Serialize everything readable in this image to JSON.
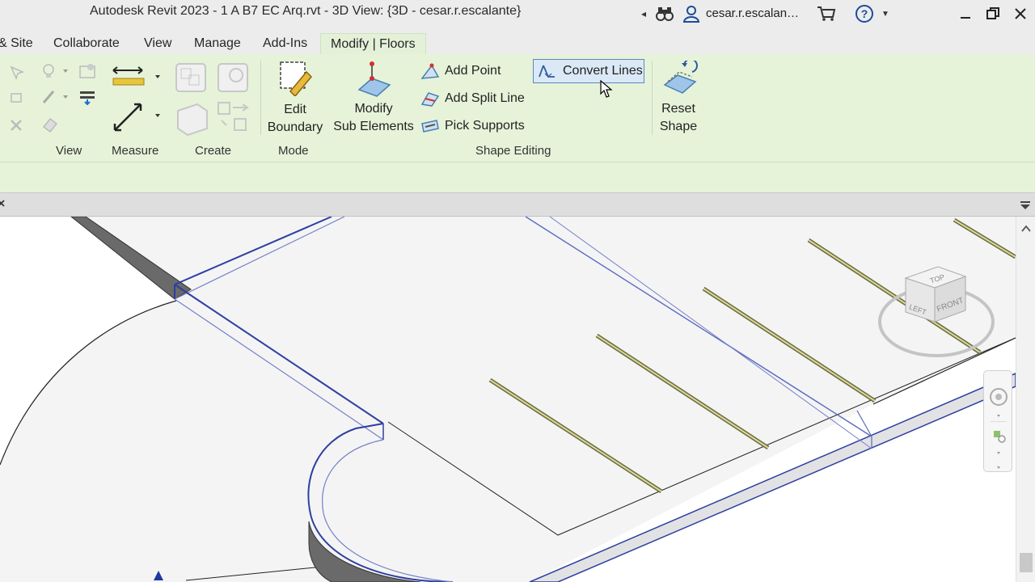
{
  "titlebar": {
    "title": "Autodesk Revit 2023 - 1 A B7 EC Arq.rvt - 3D View: {3D - cesar.r.escalante}",
    "user": "cesar.r.escalan…"
  },
  "tabs": [
    {
      "label": "& Site"
    },
    {
      "label": "Collaborate"
    },
    {
      "label": "View"
    },
    {
      "label": "Manage"
    },
    {
      "label": "Add-Ins"
    },
    {
      "label": "Modify | Floors"
    }
  ],
  "ribbon": {
    "panels": {
      "view": "View",
      "measure": "Measure",
      "create": "Create",
      "mode": "Mode",
      "shape_editing": "Shape Editing"
    },
    "edit_boundary": {
      "line1": "Edit",
      "line2": "Boundary"
    },
    "modify_sub": {
      "line1": "Modify",
      "line2": "Sub Elements"
    },
    "add_point": "Add Point",
    "add_split_line": "Add Split Line",
    "pick_supports": "Pick Supports",
    "convert_lines": "Convert Lines",
    "reset_shape": {
      "line1": "Reset",
      "line2": "Shape"
    }
  },
  "viewcube": {
    "top": "TOP",
    "left": "LEFT",
    "front": "FRONT"
  },
  "colors": {
    "ribbon_bg": "#e6f3d9",
    "selection_blue": "#2d3fa0",
    "highlight_blue": "#5a87c4"
  }
}
